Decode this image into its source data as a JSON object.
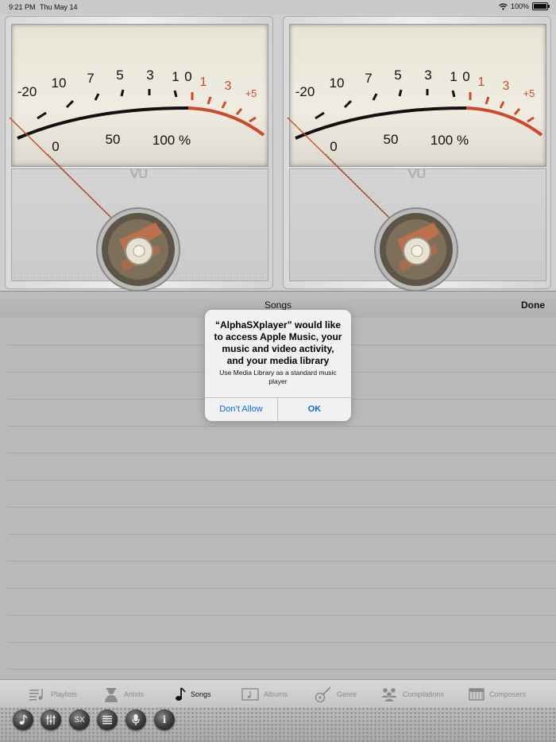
{
  "status_bar": {
    "time": "9:21 PM",
    "date": "Thu May 14",
    "battery": "100%"
  },
  "meters": {
    "scale_labels": [
      "-20",
      "10",
      "7",
      "5",
      "3",
      "1",
      "0",
      "1",
      "3",
      "+5"
    ],
    "percent_labels": [
      "0",
      "50",
      "100 %"
    ],
    "vu_label": "VU"
  },
  "songs_panel": {
    "title": "Songs",
    "done_label": "Done"
  },
  "alert": {
    "title": "“AlphaSXplayer” would like to access Apple Music, your music and video activity, and your media library",
    "message": "Use Media Library as a standard music player",
    "deny_label": "Don’t Allow",
    "ok_label": "OK"
  },
  "tabs": [
    {
      "label": "Playlists",
      "icon": "playlist-icon"
    },
    {
      "label": "Artists",
      "icon": "artist-icon"
    },
    {
      "label": "Songs",
      "icon": "music-note-icon",
      "active": true
    },
    {
      "label": "Albums",
      "icon": "album-icon"
    },
    {
      "label": "Genre",
      "icon": "guitar-icon"
    },
    {
      "label": "Compilations",
      "icon": "compilations-icon"
    },
    {
      "label": "Composers",
      "icon": "piano-icon"
    }
  ],
  "toolbar": {
    "buttons": [
      "music-note-icon",
      "equalizer-icon",
      "sx-icon",
      "list-icon",
      "microphone-icon",
      "info-icon"
    ],
    "sx_label": "SX",
    "info_label": "i"
  },
  "colors": {
    "accent": "#0b6fe0",
    "meter_red": "#d0482a"
  }
}
